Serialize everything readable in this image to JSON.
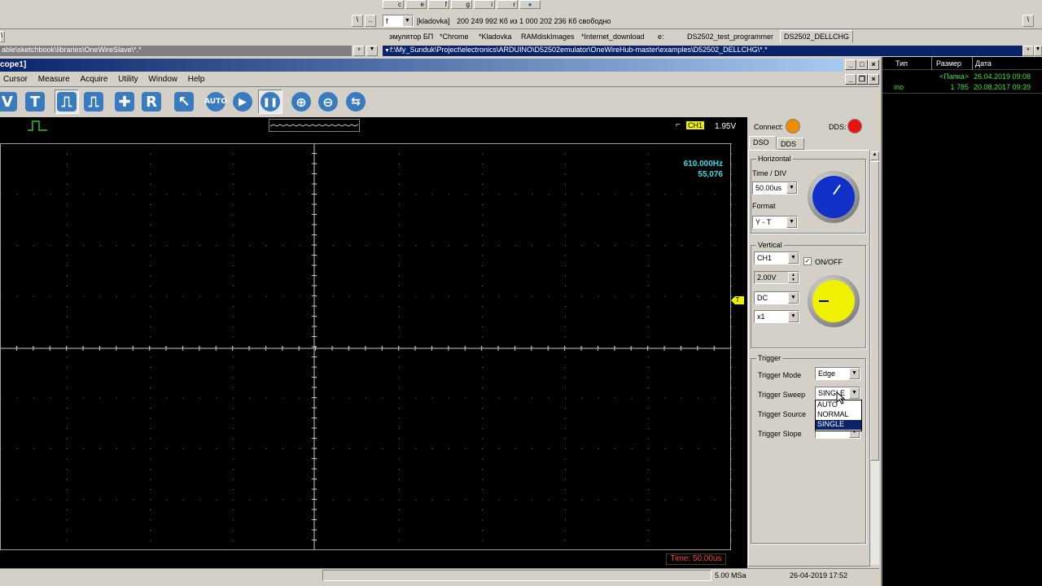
{
  "topbar": {
    "drive_combo": "f",
    "disk_label": "[kladovka]",
    "disk_info": "200 249 992 Кб из 1 000 202 236 Кб свободно",
    "left_path": "able\\sketchbook\\libraries\\OneWireSlave\\*.*",
    "right_path": "f:\\My_Sunduk\\Project\\electronics\\ARDUINO\\D52502emulator\\OneWireHub-master\\examples\\D52502_DELLCHG\\*.*",
    "tabs": [
      "эмулятор БП",
      "*Chrome",
      "*Kladovka",
      "RAMdiskImages",
      "*Internet_download",
      "e:",
      "DS2502_test_programmer",
      "DS2502_DELLCHG"
    ],
    "small_btns": [
      "c",
      "e",
      "f",
      "g",
      "i",
      "r"
    ],
    "backslash": "\\",
    "dotdot": "..",
    "star": "*"
  },
  "file_panel": {
    "headers": [
      "Тип",
      "Размер",
      "Дата"
    ],
    "rows": [
      {
        "type": "",
        "size": "<Папка>",
        "date": "26.04.2019 09:08"
      },
      {
        "type": "ino",
        "size": "1 785",
        "date": "20.08.2017 09:39"
      }
    ]
  },
  "app": {
    "title": "cope1]",
    "menu": [
      "Cursor",
      "Measure",
      "Acquire",
      "Utility",
      "Window",
      "Help"
    ],
    "toolbar": [
      {
        "name": "v-button",
        "glyph": "V"
      },
      {
        "name": "t-button",
        "glyph": "T"
      },
      {
        "name": "pulse-button",
        "glyph": "⎍"
      },
      {
        "name": "pulse-multi-button",
        "glyph": "⎍"
      },
      {
        "name": "measure-button",
        "glyph": "✚"
      },
      {
        "name": "r-button",
        "glyph": "R"
      },
      {
        "name": "cursor-button",
        "glyph": "↖"
      },
      {
        "name": "auto-button",
        "glyph": "AUTO"
      },
      {
        "name": "play-button",
        "glyph": "▶"
      },
      {
        "name": "pause-button",
        "glyph": "❚❚"
      },
      {
        "name": "zoom-in-button",
        "glyph": "⊕"
      },
      {
        "name": "zoom-out-button",
        "glyph": "⊖"
      },
      {
        "name": "swap-button",
        "glyph": "⇆"
      }
    ],
    "trigger_status": {
      "channel": "CH1",
      "level": "1.95V"
    },
    "scope": {
      "frequency": "610.000Hz",
      "count": "55,076",
      "time_label": "Time: 50.00us"
    },
    "status": {
      "sample": "5.00 MSa",
      "datetime": "26-04-2019  17:52"
    },
    "panel": {
      "connect_label": "Connect:",
      "dds_label": "DDS:",
      "connect_color": "#f08c00",
      "dds_color": "#ee1111",
      "tabs": [
        "DSO",
        "DDS"
      ],
      "horizontal": {
        "title": "Horizontal",
        "time_div_label": "Time / DIV",
        "time_div_value": "50.00us",
        "format_label": "Format",
        "format_value": "Y - T",
        "knob_color": "#1030c8"
      },
      "vertical": {
        "title": "Vertical",
        "channel": "CH1",
        "onoff_label": "ON/OFF",
        "volts": "2.00V",
        "coupling": "DC",
        "probe": "x1",
        "knob_color": "#f0f000"
      },
      "trigger": {
        "title": "Trigger",
        "mode_label": "Trigger Mode",
        "mode_value": "Edge",
        "sweep_label": "Trigger Sweep",
        "sweep_value": "SINGLE",
        "source_label": "Trigger Source",
        "slope_label": "Trigger Slope",
        "dropdown_options": [
          "AUTO",
          "NORMAL",
          "SINGLE"
        ],
        "dropdown_selected": "SINGLE"
      }
    },
    "trigger_marker": "T"
  },
  "colors": {
    "cyan_text": "#40d8e8",
    "time_label": "#ff4040",
    "highlight": "#0a246a"
  }
}
